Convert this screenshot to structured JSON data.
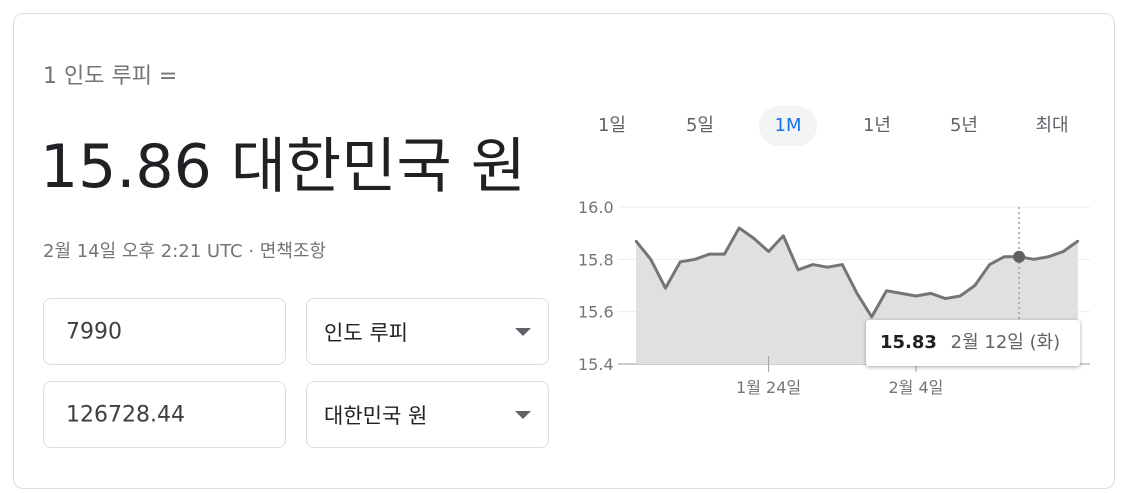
{
  "converter": {
    "from_label": "1 인도 루피 =",
    "rate_result": "15.86 대한민국 원",
    "timestamp": "2월 14일 오후 2:21 UTC",
    "separator": "·",
    "disclaimer": "면책조항",
    "amount_from": "7990",
    "currency_from": "인도 루피",
    "amount_to": "126728.44",
    "currency_to": "대한민국 원"
  },
  "range_tabs": [
    {
      "label": "1일",
      "active": false
    },
    {
      "label": "5일",
      "active": false
    },
    {
      "label": "1M",
      "active": true
    },
    {
      "label": "1년",
      "active": false
    },
    {
      "label": "5년",
      "active": false
    },
    {
      "label": "최대",
      "active": false
    }
  ],
  "tooltip": {
    "value": "15.83",
    "date": "2월 12일 (화)"
  },
  "chart_data": {
    "type": "area",
    "title": "",
    "xlabel": "",
    "ylabel": "",
    "ylim": [
      15.4,
      16.0
    ],
    "yticks": [
      "16.0",
      "15.8",
      "15.6",
      "15.4"
    ],
    "xtick_labels": [
      {
        "label": "1월 24일",
        "index": 9
      },
      {
        "label": "2월 4일",
        "index": 19
      }
    ],
    "highlight_index": 26,
    "line_color": "#757575",
    "fill_color": "#e0e0e0",
    "series": [
      {
        "values": [
          15.87,
          15.8,
          15.69,
          15.79,
          15.8,
          15.82,
          15.82,
          15.92,
          15.88,
          15.83,
          15.89,
          15.76,
          15.78,
          15.77,
          15.78,
          15.67,
          15.58,
          15.68,
          15.67,
          15.66,
          15.67,
          15.65,
          15.66,
          15.7,
          15.78,
          15.81,
          15.81,
          15.8,
          15.81,
          15.83,
          15.87
        ]
      }
    ]
  }
}
